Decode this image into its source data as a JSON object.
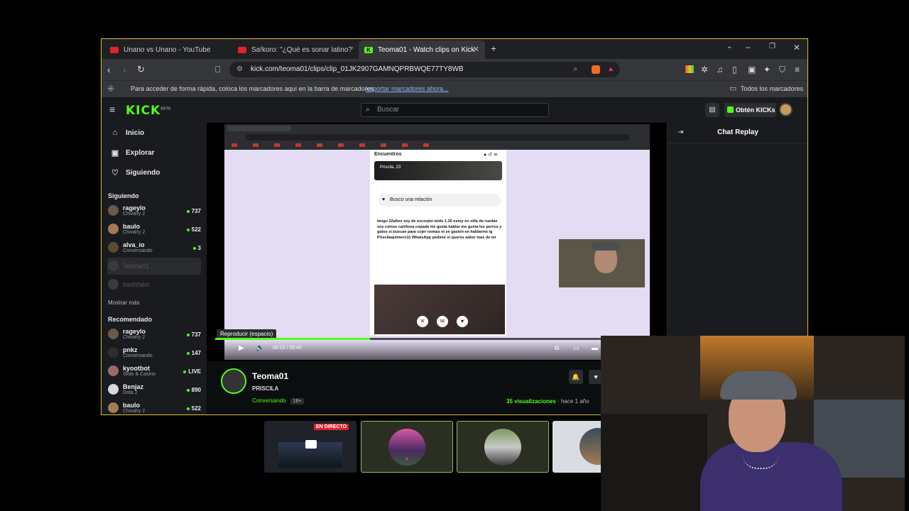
{
  "browser": {
    "tabs": [
      {
        "title": "Unano vs Unano - YouTube",
        "icon": "youtube-icon"
      },
      {
        "title": "Sa!koro: \"¿Qué es sonar latino?\" | En",
        "icon": "youtube-icon"
      },
      {
        "title": "Teoma01 - Watch clips on Kick",
        "icon": "kick-icon",
        "active": true
      }
    ],
    "url": "kick.com/teoma01/clips/clip_01JK2907GAMNQPRBWQE77TY8WB",
    "bookmarks_hint": "Para acceder de forma rápida, coloca los marcadores aquí en la barra de marcadores",
    "bookmarks_import": "Importar marcadores ahora...",
    "all_bookmarks": "Todos los marcadores"
  },
  "kick": {
    "logo": "KICK",
    "logo_badge": "BETA",
    "search_placeholder": "Buscar",
    "get_kicks": "Obtén KICKs",
    "nav": [
      {
        "label": "Inicio",
        "icon": "home-icon"
      },
      {
        "label": "Explorar",
        "icon": "browse-icon"
      },
      {
        "label": "Siguiendo",
        "icon": "heart-icon"
      }
    ],
    "following_title": "Siguiendo",
    "following": [
      {
        "name": "rageylo",
        "category": "Chivalry 2",
        "viewers": "737"
      },
      {
        "name": "baulo",
        "category": "Chivalry 2",
        "viewers": "522"
      },
      {
        "name": "alva_io",
        "category": "Conversando",
        "viewers": "3"
      },
      {
        "name": "Teoma01",
        "category": "",
        "viewers": ""
      },
      {
        "name": "trashfako",
        "category": "",
        "viewers": ""
      }
    ],
    "show_more": "Mostrar más",
    "recommended_title": "Recomendado",
    "recommended": [
      {
        "name": "rageylo",
        "category": "Chivalry 2",
        "viewers": "737"
      },
      {
        "name": "pnkz",
        "category": "Conversando",
        "viewers": "147"
      },
      {
        "name": "kyootbot",
        "category": "Slots & Casino",
        "viewers": "LIVE"
      },
      {
        "name": "Benjaz",
        "category": "Dota 2",
        "viewers": "890"
      },
      {
        "name": "baulo",
        "category": "Chivalry 2",
        "viewers": "522"
      }
    ],
    "chat_title": "Chat Replay",
    "player": {
      "tooltip": "Reproducir (espacio)",
      "time": "00:15 / 00:40",
      "progress": 0.375
    },
    "clip": {
      "channel": "Teoma01",
      "title": "PRISCILA",
      "category": "Conversando",
      "badge": "18+",
      "views": "35 visualizaciones",
      "age": "· hace 1 año"
    },
    "app": {
      "header": "Encuentros",
      "profile": "Priscila, 23",
      "looking": "Busco una relación",
      "bio": "tengo 22años soy de escorpio mido 1.30 estoy en silla de ruedas soy celose cariñosa copada me gusta hablar me gusta los perros y gatos si buscan para cojer nomas ni se gasten en hablarme ig Priscilaquintero11 WhatsApp pedime si queres saber mas de mi"
    }
  },
  "strip": {
    "live_badge": "EN DIRECTO"
  }
}
